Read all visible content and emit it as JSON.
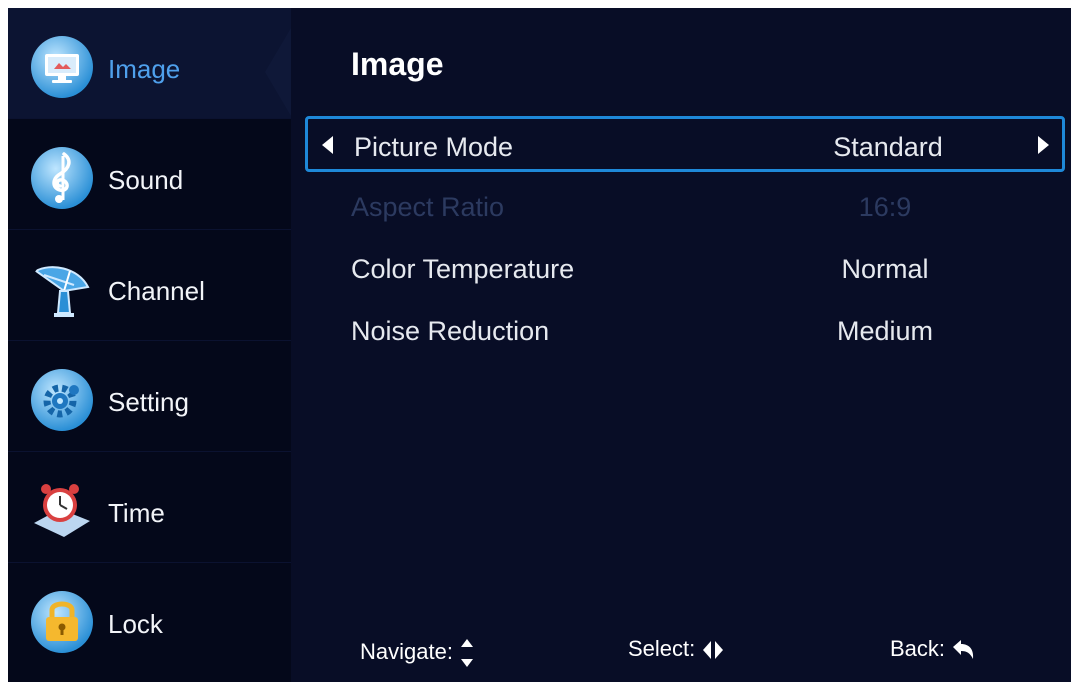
{
  "sidebar": {
    "items": [
      {
        "label": "Image",
        "icon": "monitor-icon",
        "active": true
      },
      {
        "label": "Sound",
        "icon": "music-note-icon"
      },
      {
        "label": "Channel",
        "icon": "satellite-dish-icon"
      },
      {
        "label": "Setting",
        "icon": "gear-icon"
      },
      {
        "label": "Time",
        "icon": "alarm-clock-icon"
      },
      {
        "label": "Lock",
        "icon": "padlock-icon"
      }
    ]
  },
  "main": {
    "title": "Image",
    "options": [
      {
        "label": "Picture Mode",
        "value": "Standard",
        "focused": true
      },
      {
        "label": "Aspect Ratio",
        "value": "16:9",
        "disabled": true
      },
      {
        "label": "Color Temperature",
        "value": "Normal"
      },
      {
        "label": "Noise Reduction",
        "value": "Medium"
      }
    ]
  },
  "footer": {
    "navigate": "Navigate:",
    "navigate_icon": "up-down-arrows-icon",
    "select": "Select:",
    "select_icon": "left-right-arrows-icon",
    "back": "Back:",
    "back_icon": "return-arrow-icon"
  },
  "colors": {
    "background": "#080d26",
    "sidebar": "#04081a",
    "accent": "#1e88d8",
    "active_label": "#4fa0ec",
    "disabled_text": "#2c3a60"
  }
}
